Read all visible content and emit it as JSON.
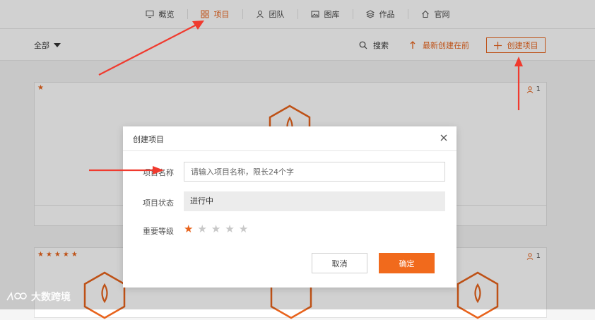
{
  "topnav": {
    "items": [
      {
        "label": "概览",
        "icon": "monitor-icon",
        "active": false
      },
      {
        "label": "项目",
        "icon": "grid-icon",
        "active": true
      },
      {
        "label": "团队",
        "icon": "team-icon",
        "active": false
      },
      {
        "label": "图库",
        "icon": "image-icon",
        "active": false
      },
      {
        "label": "作品",
        "icon": "layers-icon",
        "active": false
      },
      {
        "label": "官网",
        "icon": "home-icon",
        "active": false
      }
    ]
  },
  "toolbar": {
    "filter_label": "全部",
    "search_label": "搜索",
    "sort_label": "最新创建在前",
    "create_label": "创建项目"
  },
  "cards": [
    {
      "stars": "★",
      "members": "1"
    },
    {
      "stars": "★★★★★",
      "members": "1"
    }
  ],
  "modal": {
    "title": "创建项目",
    "name_label": "项目名称",
    "name_placeholder": "请输入项目名称，限长24个字",
    "name_value": "",
    "status_label": "项目状态",
    "status_value": "进行中",
    "priority_label": "重要等级",
    "priority_value": 1,
    "priority_max": 5,
    "cancel_label": "取消",
    "ok_label": "确定"
  },
  "watermark": "大数跨境",
  "colors": {
    "accent": "#e8631c",
    "arrow": "#f03a2e",
    "star_off": "#c8c8c8"
  }
}
